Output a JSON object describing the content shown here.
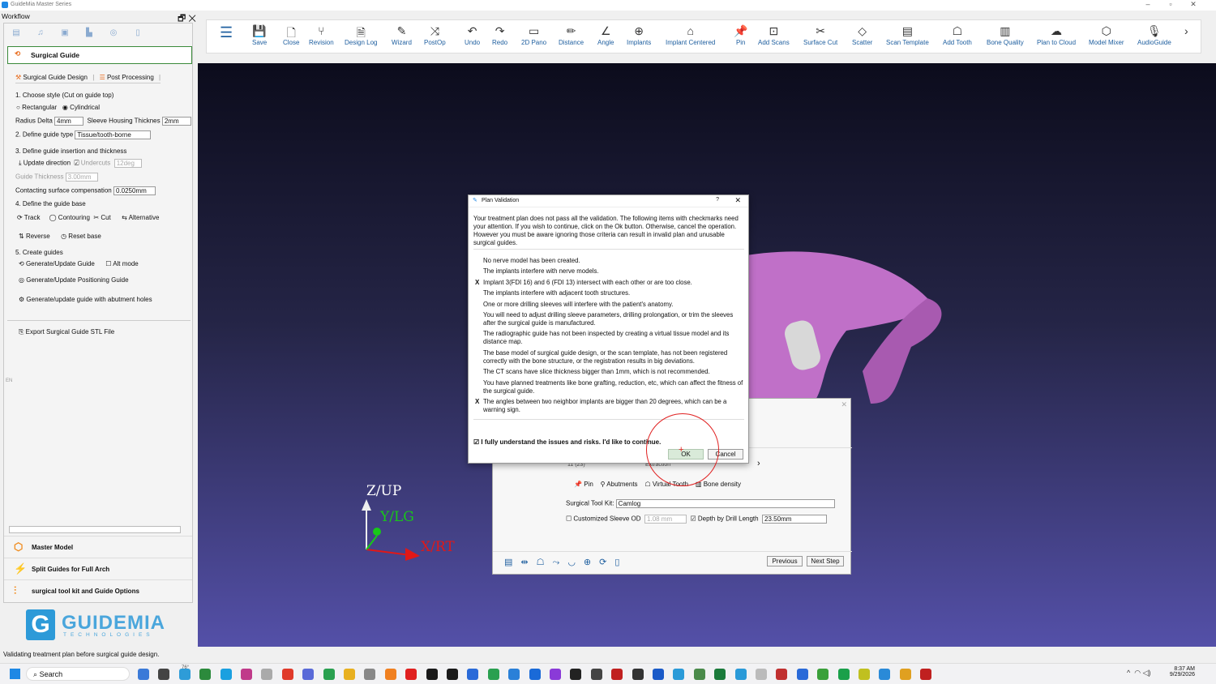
{
  "app": {
    "title": "GuideMia Master Series",
    "workflow_label": "Workflow",
    "window_controls": [
      "–",
      "▫",
      "✕"
    ],
    "dock_controls": [
      "🗗",
      "✕"
    ]
  },
  "toolbar": [
    {
      "label": "",
      "icon": "☰"
    },
    {
      "label": "Save",
      "icon": "💾"
    },
    {
      "label": "Close",
      "icon": "🗋"
    },
    {
      "label": "Revision",
      "icon": "⑂"
    },
    {
      "label": "Design Log",
      "icon": "🗎"
    },
    {
      "label": "Wizard",
      "icon": "✎"
    },
    {
      "label": "PostOp",
      "icon": "⤨"
    },
    {
      "label": "Undo",
      "icon": "↶"
    },
    {
      "label": "Redo",
      "icon": "↷"
    },
    {
      "label": "2D Pano",
      "icon": "▭"
    },
    {
      "label": "Distance",
      "icon": "✏"
    },
    {
      "label": "Angle",
      "icon": "∠"
    },
    {
      "label": "Implants",
      "icon": "⊕"
    },
    {
      "label": "Implant Centered",
      "icon": "⌂"
    },
    {
      "label": "Pin",
      "icon": "📌"
    },
    {
      "label": "Add Scans",
      "icon": "⊡"
    },
    {
      "label": "Surface Cut",
      "icon": "✂"
    },
    {
      "label": "Scatter",
      "icon": "◇"
    },
    {
      "label": "Scan Template",
      "icon": "▤"
    },
    {
      "label": "Add Tooth",
      "icon": "☖"
    },
    {
      "label": "Bone Quality",
      "icon": "▥"
    },
    {
      "label": "Plan to Cloud",
      "icon": "☁"
    },
    {
      "label": "Model Mixer",
      "icon": "⬡"
    },
    {
      "label": "AudioGuide",
      "icon": "🎙"
    },
    {
      "label": "",
      "icon": "›"
    }
  ],
  "left": {
    "section": "Surgical Guide",
    "tabs": [
      "Surgical Guide Design",
      "Post Processing"
    ],
    "step1": "1. Choose  style (Cut on guide top)",
    "rect": "Rectangular",
    "cyl": "Cylindrical",
    "radius_delta": "Radius Delta",
    "radius_val": "4mm",
    "sleeve_housing": "Sleeve Housing Thicknes",
    "sleeve_val": "2mm",
    "step2": "2. Define guide type",
    "guide_type": "Tissue/tooth-borne",
    "step3": "3. Define guide insertion and thickness",
    "update_dir": "Update direction",
    "undercuts": "Undercuts",
    "undercut_val": "12deg",
    "guide_thickness": "Guide Thickness",
    "thickness_val": "3.00mm",
    "contact_comp": "Contacting surface compensation",
    "contact_val": "0.0250mm",
    "step4": "4. Define the guide base",
    "track": "Track",
    "contouring": "Contouring",
    "cut": "Cut",
    "alternative": "Alternative",
    "reverse": "Reverse",
    "reset_base": "Reset base",
    "step5": "5. Create guides",
    "gen_update": "Generate/Update Guide",
    "alt_mode": "Alt mode",
    "gen_positioning": "Generate/Update Positioning Guide",
    "gen_abutment": "Generate/update guide with abutment holes",
    "export": "Export Surgical Guide STL File",
    "side_mark": "EN",
    "nav": [
      "Master Model",
      "Split Guides for Full Arch",
      "surgical tool kit and Guide Options"
    ]
  },
  "logo": {
    "word": "GUIDEMIA",
    "sub": "TECHNOLOGIES",
    "mark": "G"
  },
  "status": "Validating treatment plan before surgical guide design.",
  "axes": {
    "z": "Z/UP",
    "y": "Y/LG",
    "x": "X/RT"
  },
  "wizard": {
    "pin": "Pin",
    "abutments": "Abutments",
    "virtual_tooth": "Virtual Tooth",
    "bone_density": "Bone density",
    "kit_label": "Surgical Tool Kit:",
    "kit_val": "Camlog",
    "custom_sleeve": "Customized Sleeve OD",
    "sleeve_od": "1.08 mm",
    "depth_label": "Depth by Drill Length",
    "depth_val": "23.50mm",
    "previous": "Previous",
    "next": "Next Step",
    "partial1": "11 (23)",
    "partial2": "Extraction"
  },
  "dialog": {
    "title": "Plan Validation",
    "help": "?",
    "close": "✕",
    "message": "Your treatment plan does not pass all the validation. The following items with checkmarks need your attention. If you wish to continue, click on the Ok button. Otherwise, cancel the operation. However you must be aware ignoring those criteria can result in invalid plan and unusable surgical guides.",
    "items": [
      {
        "mark": "",
        "text": "No nerve model has been created."
      },
      {
        "mark": "",
        "text": "The implants interfere with nerve models."
      },
      {
        "mark": "X",
        "text": "Implant 3(FDI 16) and 6 (FDI 13) intersect with each other or are too close."
      },
      {
        "mark": "",
        "text": "The implants interfere with adjacent tooth structures."
      },
      {
        "mark": "",
        "text": "One or more drilling sleeves will interfere with the patient's anatomy."
      },
      {
        "mark": "",
        "text": "You will need to adjust drilling sleeve parameters, drilling prolongation, or trim the sleeves after the surgical guide is manufactured."
      },
      {
        "mark": "",
        "text": "The radiographic guide has not been inspected by creating a virtual tissue model and its distance map."
      },
      {
        "mark": "",
        "text": "The base model of surgical guide design, or the scan template, has not been registered correctly with the bone structure, or the registration results in big deviations."
      },
      {
        "mark": "",
        "text": "The CT scans have slice thickness bigger than 1mm, which is not recommended."
      },
      {
        "mark": "",
        "text": "You have planned treatments like bone grafting, reduction, etc, which can affect the fitness of the surgical guide."
      },
      {
        "mark": "X",
        "text": "The angles between two neighbor implants are bigger than 20 degrees, which can be a warning sign."
      }
    ],
    "confirm": "I fully understand the issues and risks. I'd like to continue.",
    "ok": "OK",
    "cancel": "Cancel"
  },
  "taskbar": {
    "search": "Search",
    "weather": "76°",
    "time": "8:37 AM",
    "date": "9/29/2026"
  }
}
